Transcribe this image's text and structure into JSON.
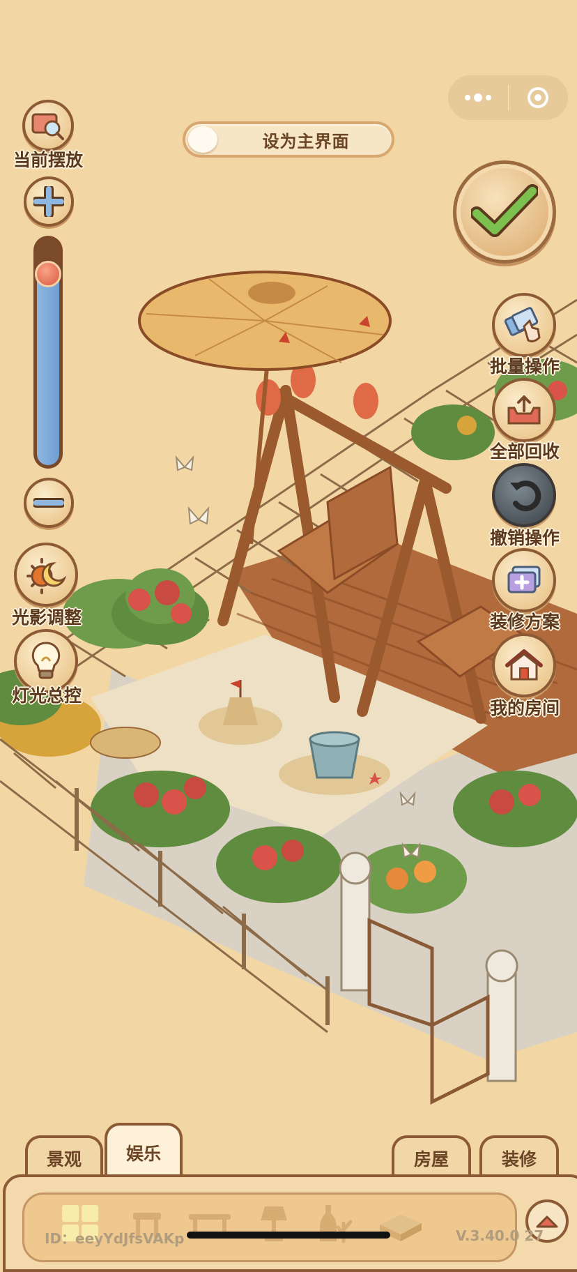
{
  "toolbar": {
    "set_main_label": "设为主界面"
  },
  "left_buttons": {
    "current_placement": "当前摆放",
    "light_shadow": "光影调整",
    "light_control": "灯光总控"
  },
  "zoom": {
    "level": 0.88
  },
  "right_buttons": {
    "batch": "批量操作",
    "recycle_all": "全部回收",
    "undo": "撤销操作",
    "plans": "装修方案",
    "my_room": "我的房间"
  },
  "tabs": {
    "landscape": "景观",
    "entertainment": "娱乐",
    "house": "房屋",
    "decoration": "装修"
  },
  "footer": {
    "id": "ID：eeyYdJfsVAKp",
    "version": "V.3.40.0 27"
  },
  "colors": {
    "background": "#f2d7a5",
    "accent_brown": "#8c5a35",
    "check_green": "#6fb04a"
  },
  "icons": [
    "more-dots-icon",
    "target-icon",
    "magnifier-icon",
    "plus-icon",
    "minus-icon",
    "sun-moon-icon",
    "light-bulb-icon",
    "check-icon",
    "hand-cards-icon",
    "recycle-tray-icon",
    "undo-arrow-icon",
    "plan-add-icon",
    "house-icon",
    "chevron-up-icon"
  ]
}
